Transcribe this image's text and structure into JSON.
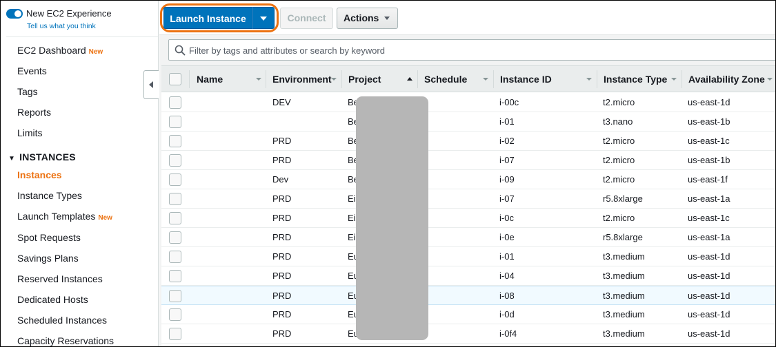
{
  "sidebar": {
    "experience_title": "New EC2 Experience",
    "experience_link": "Tell us what you think",
    "new_badge": "New",
    "items_top": [
      "EC2 Dashboard",
      "Events",
      "Tags",
      "Reports",
      "Limits"
    ],
    "section_title": "INSTANCES",
    "items_instances": [
      "Instances",
      "Instance Types",
      "Launch Templates",
      "Spot Requests",
      "Savings Plans",
      "Reserved Instances",
      "Dedicated Hosts",
      "Scheduled Instances",
      "Capacity Reservations"
    ],
    "active_item": "Instances"
  },
  "toolbar": {
    "launch_label": "Launch Instance",
    "connect_label": "Connect",
    "actions_label": "Actions"
  },
  "search": {
    "placeholder": "Filter by tags and attributes or search by keyword"
  },
  "table": {
    "columns": [
      "Name",
      "Environment",
      "Project",
      "Schedule",
      "Instance ID",
      "Instance Type",
      "Availability Zone"
    ],
    "sorted_column": "Project",
    "rows": [
      {
        "name": "",
        "environment": "DEV",
        "project": "Beta",
        "schedule": "",
        "instance_id": "i-00c",
        "instance_type": "t2.micro",
        "az": "us-east-1d"
      },
      {
        "name": "",
        "environment": "",
        "project": "Beta",
        "schedule": "",
        "instance_id": "i-01",
        "instance_type": "t3.nano",
        "az": "us-east-1b"
      },
      {
        "name": "",
        "environment": "PRD",
        "project": "Beta",
        "schedule": "",
        "instance_id": "i-02",
        "instance_type": "t2.micro",
        "az": "us-east-1c"
      },
      {
        "name": "",
        "environment": "PRD",
        "project": "Beta",
        "schedule": "",
        "instance_id": "i-07",
        "instance_type": "t2.micro",
        "az": "us-east-1b"
      },
      {
        "name": "",
        "environment": "Dev",
        "project": "Beta",
        "schedule": "",
        "instance_id": "i-09",
        "instance_type": "t2.micro",
        "az": "us-east-1f"
      },
      {
        "name": "",
        "environment": "PRD",
        "project": "Einstein",
        "schedule": "",
        "instance_id": "i-07",
        "instance_type": "r5.8xlarge",
        "az": "us-east-1a"
      },
      {
        "name": "",
        "environment": "PRD",
        "project": "Einstein",
        "schedule": "",
        "instance_id": "i-0c",
        "instance_type": "t2.micro",
        "az": "us-east-1c"
      },
      {
        "name": "",
        "environment": "PRD",
        "project": "Einstein",
        "schedule": "",
        "instance_id": "i-0e",
        "instance_type": "r5.8xlarge",
        "az": "us-east-1a"
      },
      {
        "name": "",
        "environment": "PRD",
        "project": "Euler",
        "schedule": "",
        "instance_id": "i-01",
        "instance_type": "t3.medium",
        "az": "us-east-1d"
      },
      {
        "name": "",
        "environment": "PRD",
        "project": "Euler",
        "schedule": "",
        "instance_id": "i-04",
        "instance_type": "t3.medium",
        "az": "us-east-1d"
      },
      {
        "name": "",
        "environment": "PRD",
        "project": "Euler",
        "schedule": "",
        "instance_id": "i-08",
        "instance_type": "t3.medium",
        "az": "us-east-1d",
        "highlighted": true
      },
      {
        "name": "",
        "environment": "PRD",
        "project": "Euler",
        "schedule": "",
        "instance_id": "i-0d",
        "instance_type": "t3.medium",
        "az": "us-east-1d"
      },
      {
        "name": "",
        "environment": "PRD",
        "project": "Euler",
        "schedule": "",
        "instance_id": "i-0f4",
        "instance_type": "t3.medium",
        "az": "us-east-1d"
      }
    ]
  },
  "colors": {
    "accent": "#0073bb",
    "highlight_ring": "#ec7211",
    "active_nav": "#ec7211"
  }
}
